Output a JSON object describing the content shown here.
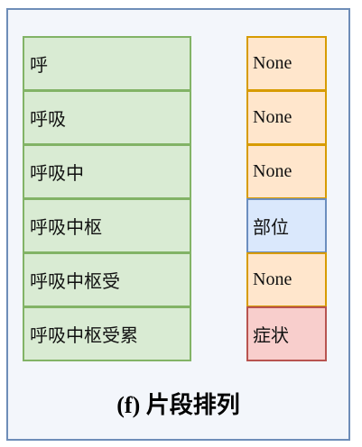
{
  "segments": [
    {
      "text": "呼",
      "tag": "None",
      "tag_type": "none"
    },
    {
      "text": "呼吸",
      "tag": "None",
      "tag_type": "none"
    },
    {
      "text": "呼吸中",
      "tag": "None",
      "tag_type": "none"
    },
    {
      "text": "呼吸中枢",
      "tag": "部位",
      "tag_type": "location"
    },
    {
      "text": "呼吸中枢受",
      "tag": "None",
      "tag_type": "none"
    },
    {
      "text": "呼吸中枢受累",
      "tag": "症状",
      "tag_type": "symptom"
    }
  ],
  "caption": {
    "label": "(f)",
    "text": "片段排列"
  },
  "colors": {
    "panel_fill": "#f3f6fb",
    "panel_border": "#6e8db8",
    "segment_fill": "#d9ebd3",
    "segment_border": "#82b366",
    "none_fill": "#ffe6cc",
    "none_border": "#d79b00",
    "location_fill": "#dae8fc",
    "location_border": "#6c8ebf",
    "symptom_fill": "#f8cecc",
    "symptom_border": "#b85450"
  }
}
